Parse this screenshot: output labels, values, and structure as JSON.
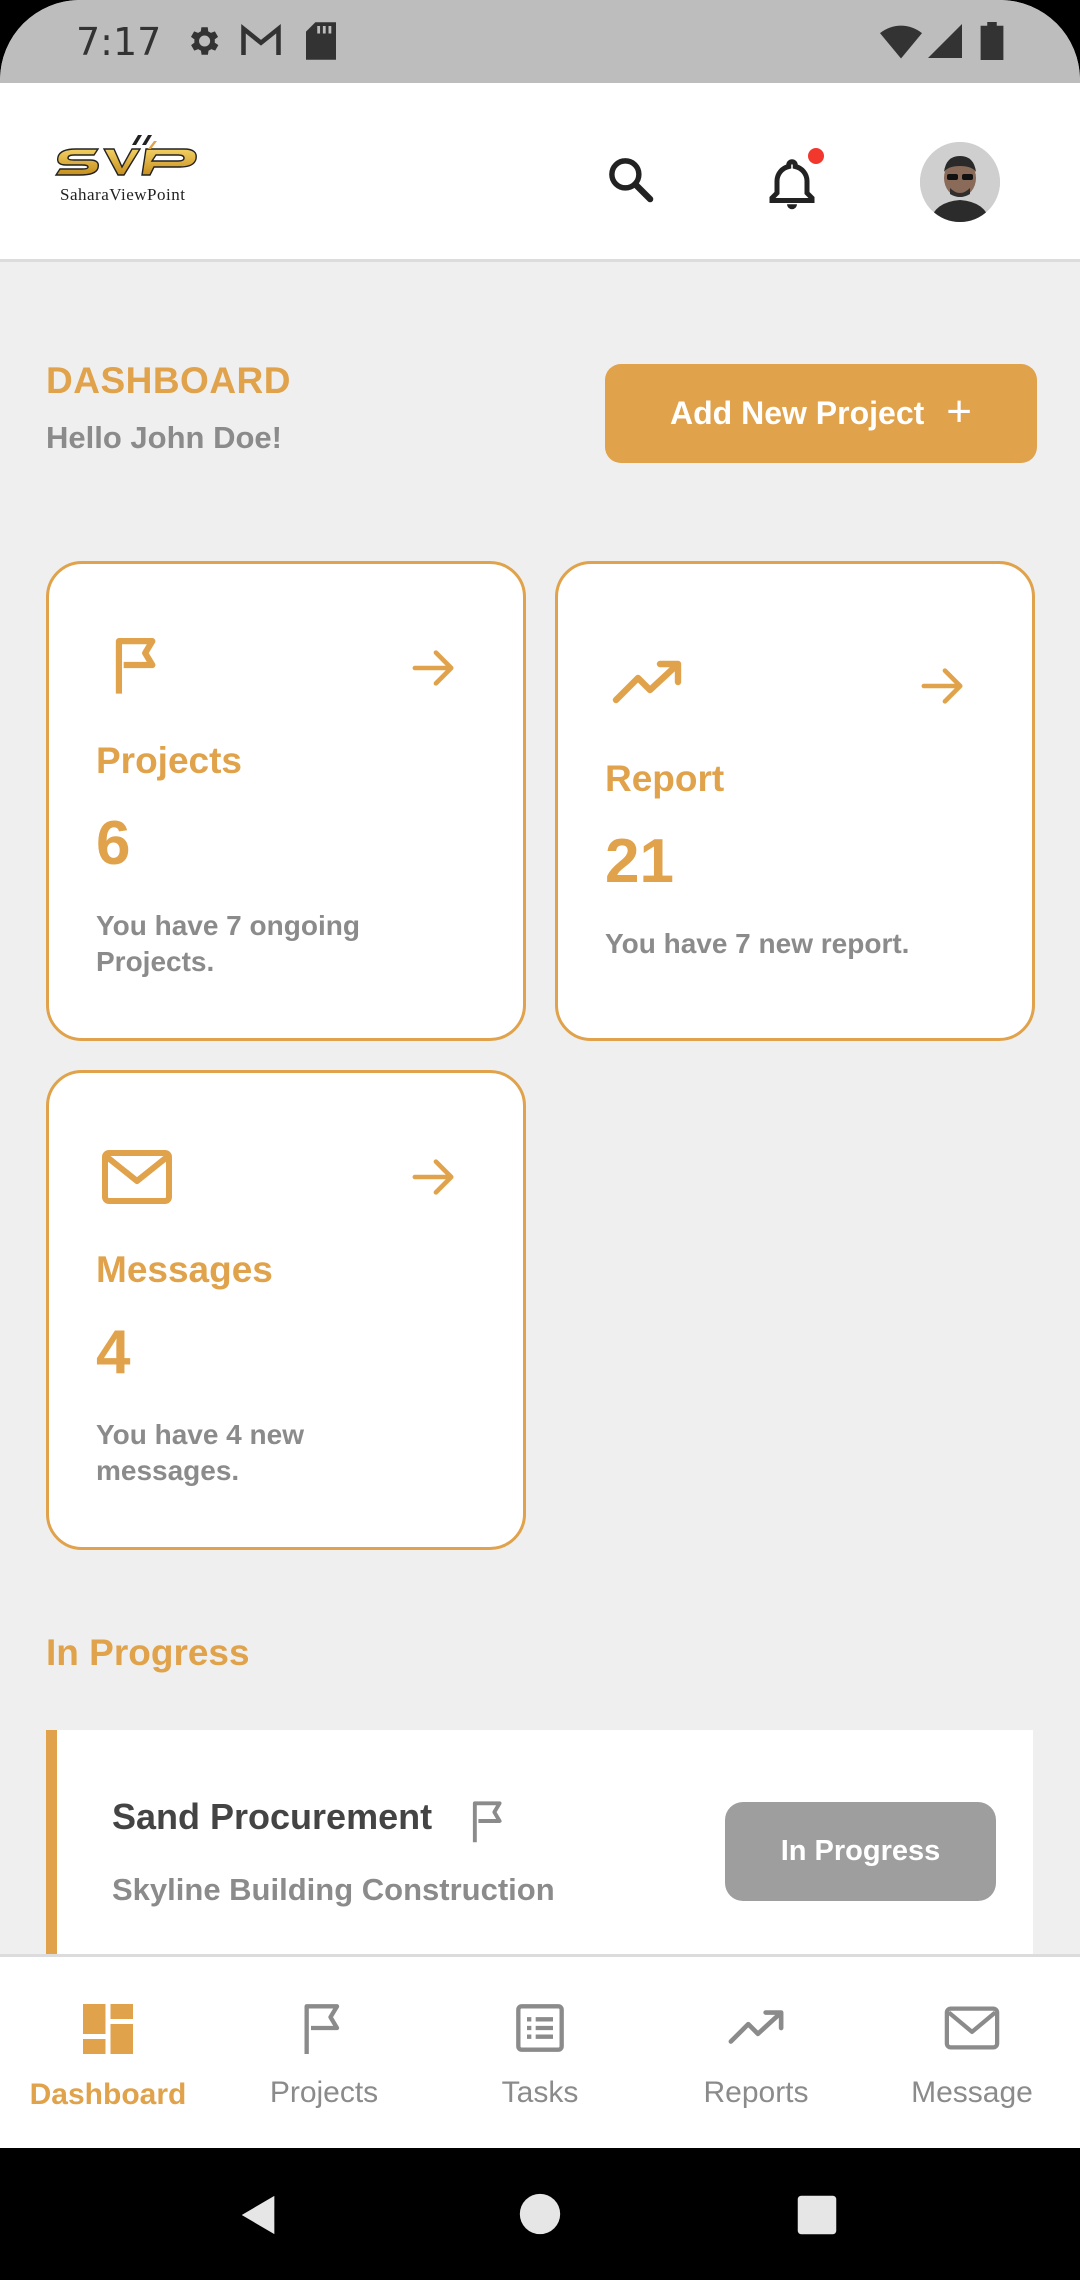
{
  "status_bar": {
    "time": "7:17"
  },
  "header": {
    "logo_text": "SVP",
    "logo_subtitle": "SaharaViewPoint",
    "notification_unread": true
  },
  "dashboard": {
    "title": "DASHBOARD",
    "greeting": "Hello John Doe!",
    "add_button_label": "Add New Project",
    "add_button_icon": "+"
  },
  "cards": {
    "projects": {
      "title": "Projects",
      "count": "6",
      "description": "You have 7 ongoing Projects.",
      "icon": "flag-icon"
    },
    "report": {
      "title": "Report",
      "count": "21",
      "description": "You have 7 new report.",
      "icon": "trending-up-icon"
    },
    "messages": {
      "title": "Messages",
      "count": "4",
      "description": "You have 4 new messages.",
      "icon": "mail-icon"
    }
  },
  "in_progress": {
    "section_title": "In Progress",
    "items": [
      {
        "name": "Sand Procurement",
        "project": "Skyline Building Construction",
        "status": "In Progress"
      }
    ]
  },
  "bottom_nav": {
    "items": [
      {
        "label": "Dashboard",
        "icon": "dashboard-icon",
        "active": true
      },
      {
        "label": "Projects",
        "icon": "flag-icon",
        "active": false
      },
      {
        "label": "Tasks",
        "icon": "list-icon",
        "active": false
      },
      {
        "label": "Reports",
        "icon": "trending-up-icon",
        "active": false
      },
      {
        "label": "Message",
        "icon": "mail-icon",
        "active": false
      }
    ]
  },
  "colors": {
    "accent": "#e0a24a",
    "background": "#efefef",
    "muted": "#8b8b8b",
    "status_pill": "#9e9e9e"
  }
}
